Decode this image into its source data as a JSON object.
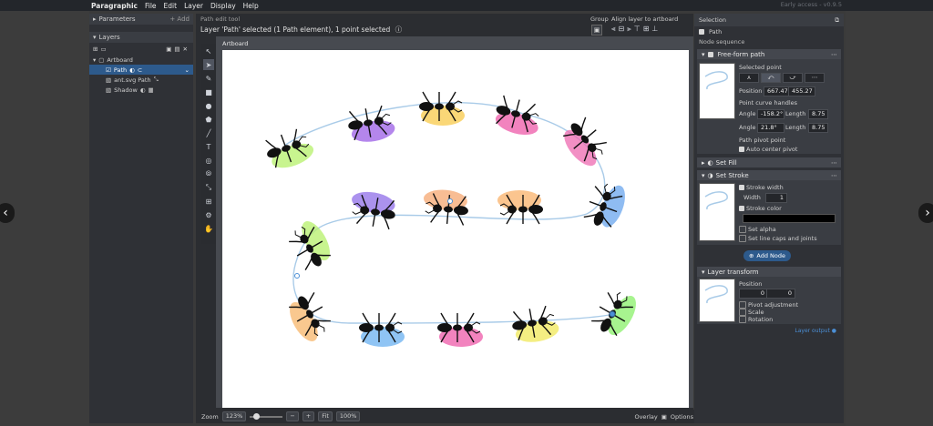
{
  "menu": [
    "Paragraphic",
    "File",
    "Edit",
    "Layer",
    "Display",
    "Help"
  ],
  "early_access": "Early access - v0.9.5",
  "left_panel": {
    "parameters": "Parameters",
    "add": "+ Add",
    "layers": "Layers",
    "artboard": "Artboard",
    "items": [
      {
        "label": "Path",
        "selected": true
      },
      {
        "label": "ant.svg Path",
        "selected": false
      },
      {
        "label": "Shadow",
        "selected": false
      }
    ]
  },
  "center": {
    "tool_title": "Path edit tool",
    "status": "Layer 'Path' selected (1 Path element), 1 point selected",
    "group_label": "Group",
    "align_label": "Align layer to artboard",
    "artboard_label": "Artboard"
  },
  "bottom": {
    "zoom_label": "Zoom",
    "zoom_value": "123%",
    "fit": "Fit",
    "hundred": "100%",
    "overlay": "Overlay",
    "options": "Options"
  },
  "selection": {
    "title": "Selection",
    "path_label": "Path",
    "node_sequence": "Node sequence",
    "freeform": {
      "title": "Free-form path",
      "selected_point": "Selected point",
      "position_label": "Position",
      "pos_x": "667.47",
      "pos_y": "455.27",
      "handles_label": "Point curve handles",
      "angle_label": "Angle",
      "length_label": "Length",
      "angle1": "-158.2°",
      "length1": "8.75",
      "angle2": "21.8°",
      "length2": "8.75",
      "pivot_label": "Path pivot point",
      "auto_center": "Auto center pivot"
    },
    "set_fill": "Set Fill",
    "set_stroke": {
      "title": "Set Stroke",
      "stroke_width": "Stroke width",
      "width_label": "Width",
      "width_value": "1",
      "stroke_color": "Stroke color",
      "color_hex": "#000000",
      "set_alpha": "Set alpha",
      "set_line_caps": "Set line caps and joints"
    },
    "add_node": "Add Node",
    "layer_transform": {
      "title": "Layer transform",
      "position_label": "Position",
      "pos_x": "0",
      "pos_y": "0",
      "pivot_adjustment": "Pivot adjustment",
      "scale": "Scale",
      "rotation": "Rotation"
    },
    "layer_output": "Layer output"
  },
  "colors": {
    "accent": "#2d5a8c",
    "path_line": "#a9cbe8",
    "ant_body": "#111111"
  },
  "ants": [
    {
      "color": "#b6f06a"
    },
    {
      "color": "#9b5ee6"
    },
    {
      "color": "#f8c94a"
    },
    {
      "color": "#ee5aa8"
    },
    {
      "color": "#ee6ab0"
    },
    {
      "color": "#6aa6ee"
    },
    {
      "color": "#f9b26a"
    },
    {
      "color": "#f5a770"
    },
    {
      "color": "#8f6ee8"
    },
    {
      "color": "#b6f06a"
    },
    {
      "color": "#f7b56a"
    },
    {
      "color": "#6ab0f0"
    },
    {
      "color": "#ee5aa8"
    },
    {
      "color": "#f0e858"
    },
    {
      "color": "#8af06a"
    }
  ]
}
